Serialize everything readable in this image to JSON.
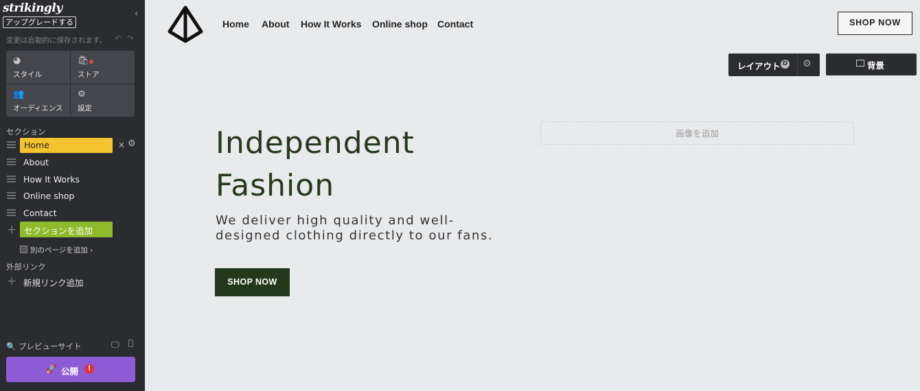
{
  "editor": {
    "logo": "strikingly",
    "upgrade_label": "アップグレードする",
    "autosave_text": "変更は自動的に保存されます。",
    "tiles": [
      {
        "label": "スタイル",
        "icon": "palette-icon"
      },
      {
        "label": "ストア",
        "icon": "shopping-bag-icon"
      },
      {
        "label": "オーディエンス",
        "icon": "people-icon"
      },
      {
        "label": "設定",
        "icon": "gear-icon"
      }
    ],
    "sections_title": "セクション",
    "sections": [
      {
        "label": "Home",
        "active": true
      },
      {
        "label": "About",
        "active": false
      },
      {
        "label": "How It Works",
        "active": false
      },
      {
        "label": "Online shop",
        "active": false
      },
      {
        "label": "Contact",
        "active": false
      }
    ],
    "add_section_label": "セクションを追加",
    "add_page_label": "別のページを追加",
    "external_links_title": "外部リンク",
    "new_link_label": "新規リンク追加",
    "preview_label": "プレビューサイト",
    "publish_label": "公開",
    "colors": {
      "sidebar_bg": "#2b2c30",
      "active_section": "#f4c430",
      "add_section": "#8fba2b",
      "publish": "#8e5bd6"
    }
  },
  "site": {
    "nav": [
      "Home",
      "About",
      "How It Works",
      "Online shop",
      "Contact"
    ],
    "shop_now_top": "SHOP NOW",
    "layout_label": "レイアウト",
    "layout_badge": "D",
    "background_label": "背景",
    "hero": {
      "title_line1": "Independent",
      "title_line2": "Fashion",
      "subtitle_line1": "We deliver high quality and well-",
      "subtitle_line2": "designed clothing directly to our fans.",
      "button_label": "SHOP NOW"
    },
    "add_image_label": "画像を追加",
    "colors": {
      "accent": "#24391c",
      "background": "#e9eaec"
    }
  }
}
